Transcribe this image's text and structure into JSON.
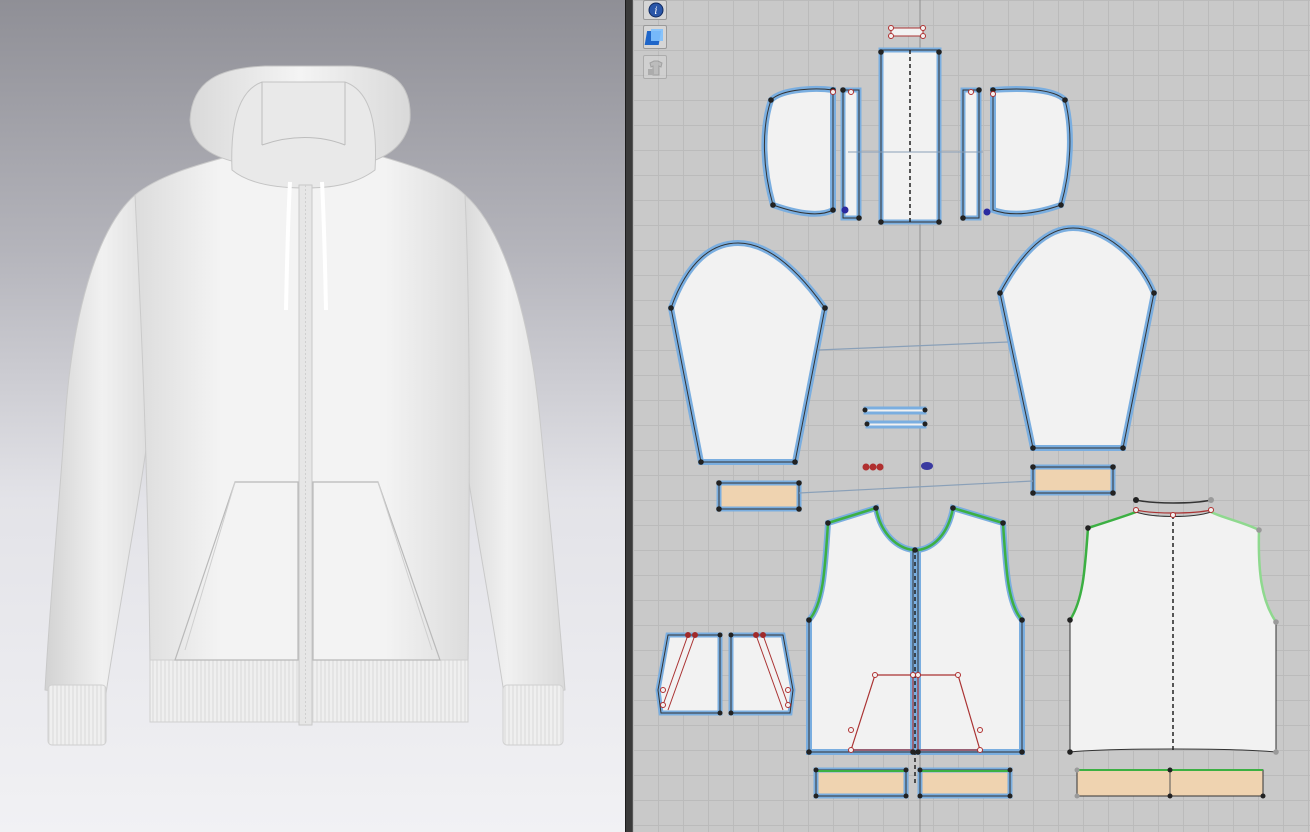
{
  "app": {
    "views": [
      "3d-view",
      "2d-pattern-view"
    ]
  },
  "toolbar": {
    "tools": [
      {
        "name": "info-tool",
        "icon": "info-icon"
      },
      {
        "name": "texture-tool",
        "icon": "fabric-swatch-icon"
      },
      {
        "name": "garment-lock-tool",
        "icon": "locked-shirt-icon"
      }
    ]
  },
  "colors": {
    "viewport_bg_top": "#8f8f96",
    "viewport_bg_bottom": "#f1f1f4",
    "pattern_bg": "#c9c9c9",
    "pattern_grid": "#bbbbbb",
    "piece_fill": "#f2f2f2",
    "rib_fill": "#efd3b0",
    "outline_selected": "#7aaee0",
    "outline_green": "#3cb043",
    "garment": "#f0f0f0"
  },
  "garment": {
    "type": "zip-up hoodie",
    "color_name": "white"
  }
}
